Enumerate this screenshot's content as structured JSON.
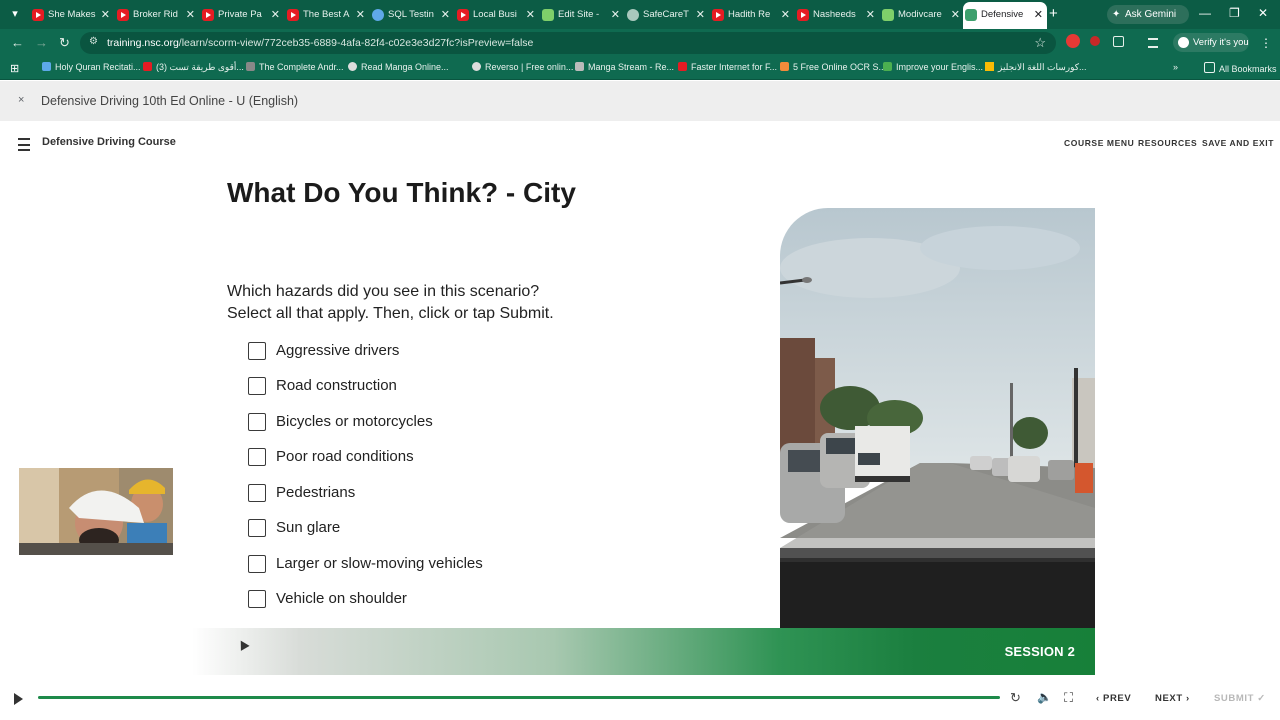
{
  "browser": {
    "tabs": [
      {
        "title": "She Makes",
        "icon": "youtube-icon"
      },
      {
        "title": "Broker Rid",
        "icon": "youtube-icon"
      },
      {
        "title": "Private Pa",
        "icon": "youtube-icon"
      },
      {
        "title": "The Best A",
        "icon": "youtube-icon"
      },
      {
        "title": "SQL Testin",
        "icon": "globe-icon"
      },
      {
        "title": "Local Busi",
        "icon": "youtube-icon"
      },
      {
        "title": "Edit Site -",
        "icon": "site-icon"
      },
      {
        "title": "SafeCareT",
        "icon": "globe-icon"
      },
      {
        "title": "Hadith Re",
        "icon": "youtube-icon"
      },
      {
        "title": "Nasheeds",
        "icon": "youtube-icon"
      },
      {
        "title": "Modivcare",
        "icon": "grid-icon"
      },
      {
        "title": "Defensive",
        "icon": "nsc-icon",
        "active": true
      }
    ],
    "gemini_label": "Ask Gemini",
    "url_host": "training.nsc.org",
    "url_path": "/learn/scorm-view/772ceb35-6889-4afa-82f4-c02e3e3d27fc?isPreview=false",
    "verify_label": "Verify it's you",
    "bookmarks": [
      "Holy Quran Recitati...",
      "(3) أقوى طريقة تست...",
      "The Complete Andr...",
      "Read Manga Online...",
      "Reverso | Free onlin...",
      "Manga Stream - Re...",
      "Faster Internet for F...",
      "5 Free Online OCR S...",
      "Improve your Englis...",
      "كورسات اللغة الانجليز...",
      "All Bookmarks"
    ]
  },
  "course": {
    "window_title": "Defensive Driving 10th Ed Online - U (English)",
    "app_title": "Defensive Driving Course",
    "nav": {
      "course_menu": "COURSE MENU",
      "resources": "RESOURCES",
      "save_exit": "SAVE AND EXIT"
    }
  },
  "slide": {
    "title": "What Do You Think? - City",
    "question_line1": "Which hazards did you see in this scenario?",
    "question_line2": "Select all that apply. Then, click or tap Submit.",
    "options": [
      "Aggressive drivers",
      "Road construction",
      "Bicycles or motorcycles",
      "Poor road conditions",
      "Pedestrians",
      "Sun glare",
      "Larger or slow-moving vehicles",
      "Vehicle on shoulder"
    ],
    "session_label": "SESSION 2"
  },
  "player": {
    "prev_label": "PREV",
    "next_label": "NEXT",
    "submit_label": "SUBMIT",
    "progress": 1.0
  },
  "colors": {
    "brand_green": "#178039",
    "chrome_green": "#0c5c45"
  }
}
